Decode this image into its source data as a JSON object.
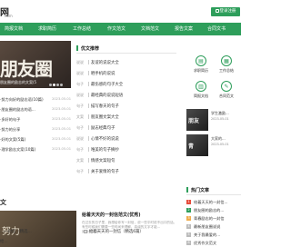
{
  "header": {
    "logo_text": "网",
    "logo_sub": ".com",
    "login_button": "登录注册"
  },
  "nav": {
    "items": [
      {
        "label": "简报文档"
      },
      {
        "label": "求职简历"
      },
      {
        "label": "工作总结"
      },
      {
        "label": "作文范文"
      },
      {
        "label": "文档范文"
      },
      {
        "label": "报告文案"
      },
      {
        "label": "合同文书"
      }
    ]
  },
  "banner": {
    "big_text": "朋友圈",
    "caption": "朋友圈的励志的文案(5"
  },
  "left_list": [
    {
      "title": "·努力向好的励志语(10篇)",
      "date": "2023-05-01"
    },
    {
      "title": "·朋友圈的励志的语...",
      "date": "2023-05-01"
    },
    {
      "title": "·多好的句子",
      "date": "2023-05-01"
    },
    {
      "title": "·努力的分享",
      "date": "2023-05-01"
    },
    {
      "title": "·好的文案(5篇)",
      "date": "2023-05-01"
    },
    {
      "title": "·理学励志文案(10篇)",
      "date": "2023-05-01"
    }
  ],
  "featured_panel": {
    "title": "优文推荐",
    "items": [
      {
        "category": "说说",
        "title": "友谊的说说大全"
      },
      {
        "category": "说说",
        "title": "晒手机的说说"
      },
      {
        "category": "句子",
        "title": "最伤感的句子大全"
      },
      {
        "category": "说说",
        "title": "最经典的说说短语"
      },
      {
        "category": "句子",
        "title": "描写春天的句子"
      },
      {
        "category": "文案",
        "title": "朋友圈文案大全"
      },
      {
        "category": "句子",
        "title": "励志经典句子"
      },
      {
        "category": "说说",
        "title": "心情不好的说说"
      },
      {
        "category": "句子",
        "title": "唯美的句子摘抄"
      },
      {
        "category": "文案",
        "title": "情感文案短句"
      },
      {
        "category": "句子",
        "title": "关于爱情的句子"
      }
    ]
  },
  "sidebar_grid": {
    "items": [
      {
        "icon": "document-icon",
        "glyph": "▤",
        "label": "求职简历"
      },
      {
        "icon": "briefcase-icon",
        "glyph": "▦",
        "label": "工作总结"
      },
      {
        "icon": "report-icon",
        "glyph": "▥",
        "label": "简报文档"
      },
      {
        "icon": "pen-icon",
        "glyph": "✎",
        "label": "合同范文"
      }
    ]
  },
  "sidebar_thumbs": [
    {
      "image_text": "朋友",
      "title": "学生激励...",
      "sub": "2023-05-01"
    },
    {
      "image_text": "青",
      "title": "大家的...",
      "sub": "2023-05-01"
    }
  ],
  "section": {
    "heading": "文"
  },
  "feature": {
    "image_text": "努力",
    "title": "给着天天的一封信范文(优秀)",
    "desc": "在过去的日子里，我想给你写一封信，说一些平时说不出口的话。",
    "desc2": "有些时候我们需要一些时间来理解，真诚的文字才能...",
    "read": "阅读全文 >"
  },
  "bottom_rows": [
    {
      "title": "...一封信（精选..."
    },
    {
      "title": "给..."
    },
    {
      "title": "给着天天的一封信（精选6篇）"
    }
  ],
  "hot": {
    "title": "热门文章",
    "items": [
      {
        "rank": "1",
        "title": "给着天天的一封信..."
      },
      {
        "rank": "2",
        "title": "朋友圈的励志的..."
      },
      {
        "rank": "3",
        "title": "青春励志的一封信"
      },
      {
        "rank": "4",
        "title": "最新朋友圈说说"
      },
      {
        "rank": "5",
        "title": "关于我最爱的..."
      },
      {
        "rank": "6",
        "title": "优秀作文范文"
      }
    ]
  },
  "colors": {
    "brand_green": "#2e9e5b"
  }
}
